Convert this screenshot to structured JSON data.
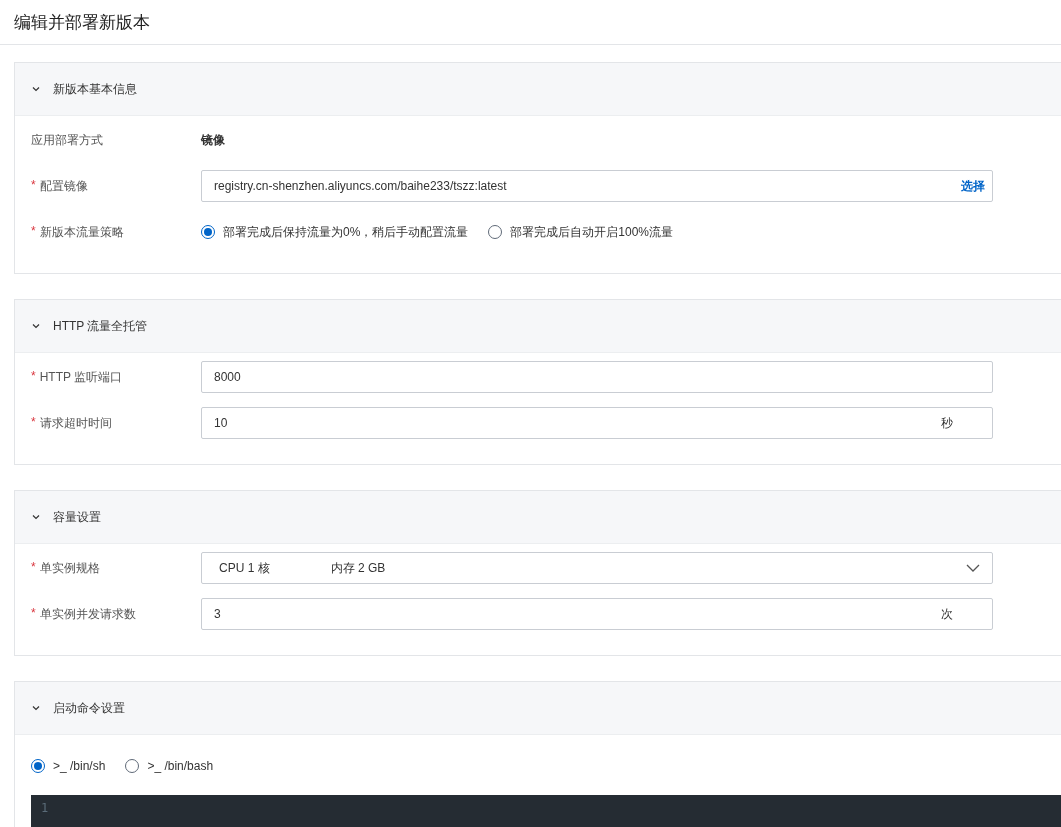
{
  "page_title": "编辑并部署新版本",
  "sections": [
    {
      "title": "新版本基本信息",
      "expanded": true,
      "rows": [
        {
          "kind": "text",
          "label": "应用部署方式",
          "value": "镜像"
        },
        {
          "kind": "input",
          "label": "配置镜像",
          "required_mark": "*",
          "value": "registry.cn-shenzhen.aliyuncs.com/baihe233/tszz:latest",
          "action": "选择"
        },
        {
          "kind": "radio",
          "label": "新版本流量策略",
          "required_mark": "*",
          "options": [
            {
              "label": "部署完成后保持流量为0%，稍后手动配置流量",
              "selected": true
            },
            {
              "label": "部署完成后自动开启100%流量",
              "selected": false
            }
          ]
        }
      ]
    },
    {
      "title": "HTTP 流量全托管",
      "expanded": true,
      "rows": [
        {
          "kind": "input",
          "label": "HTTP 监听端口",
          "required_mark": "*",
          "value": "8000"
        },
        {
          "kind": "input",
          "label": "请求超时时间",
          "required_mark": "*",
          "value": "10",
          "suffix": "秒"
        }
      ]
    },
    {
      "title": "容量设置",
      "expanded": true,
      "rows": [
        {
          "kind": "select",
          "label": "单实例规格",
          "required_mark": "*",
          "value_parts": [
            "CPU 1 核",
            "内存 2 GB"
          ]
        },
        {
          "kind": "input",
          "label": "单实例并发请求数",
          "required_mark": "*",
          "value": "3",
          "suffix": "次"
        }
      ]
    },
    {
      "title": "启动命令设置",
      "expanded": true,
      "shell_options": [
        {
          "label": ">_ /bin/sh",
          "selected": true
        },
        {
          "label": ">_ /bin/bash",
          "selected": false
        }
      ],
      "editor": {
        "line_numbers": [
          "1"
        ]
      }
    }
  ]
}
